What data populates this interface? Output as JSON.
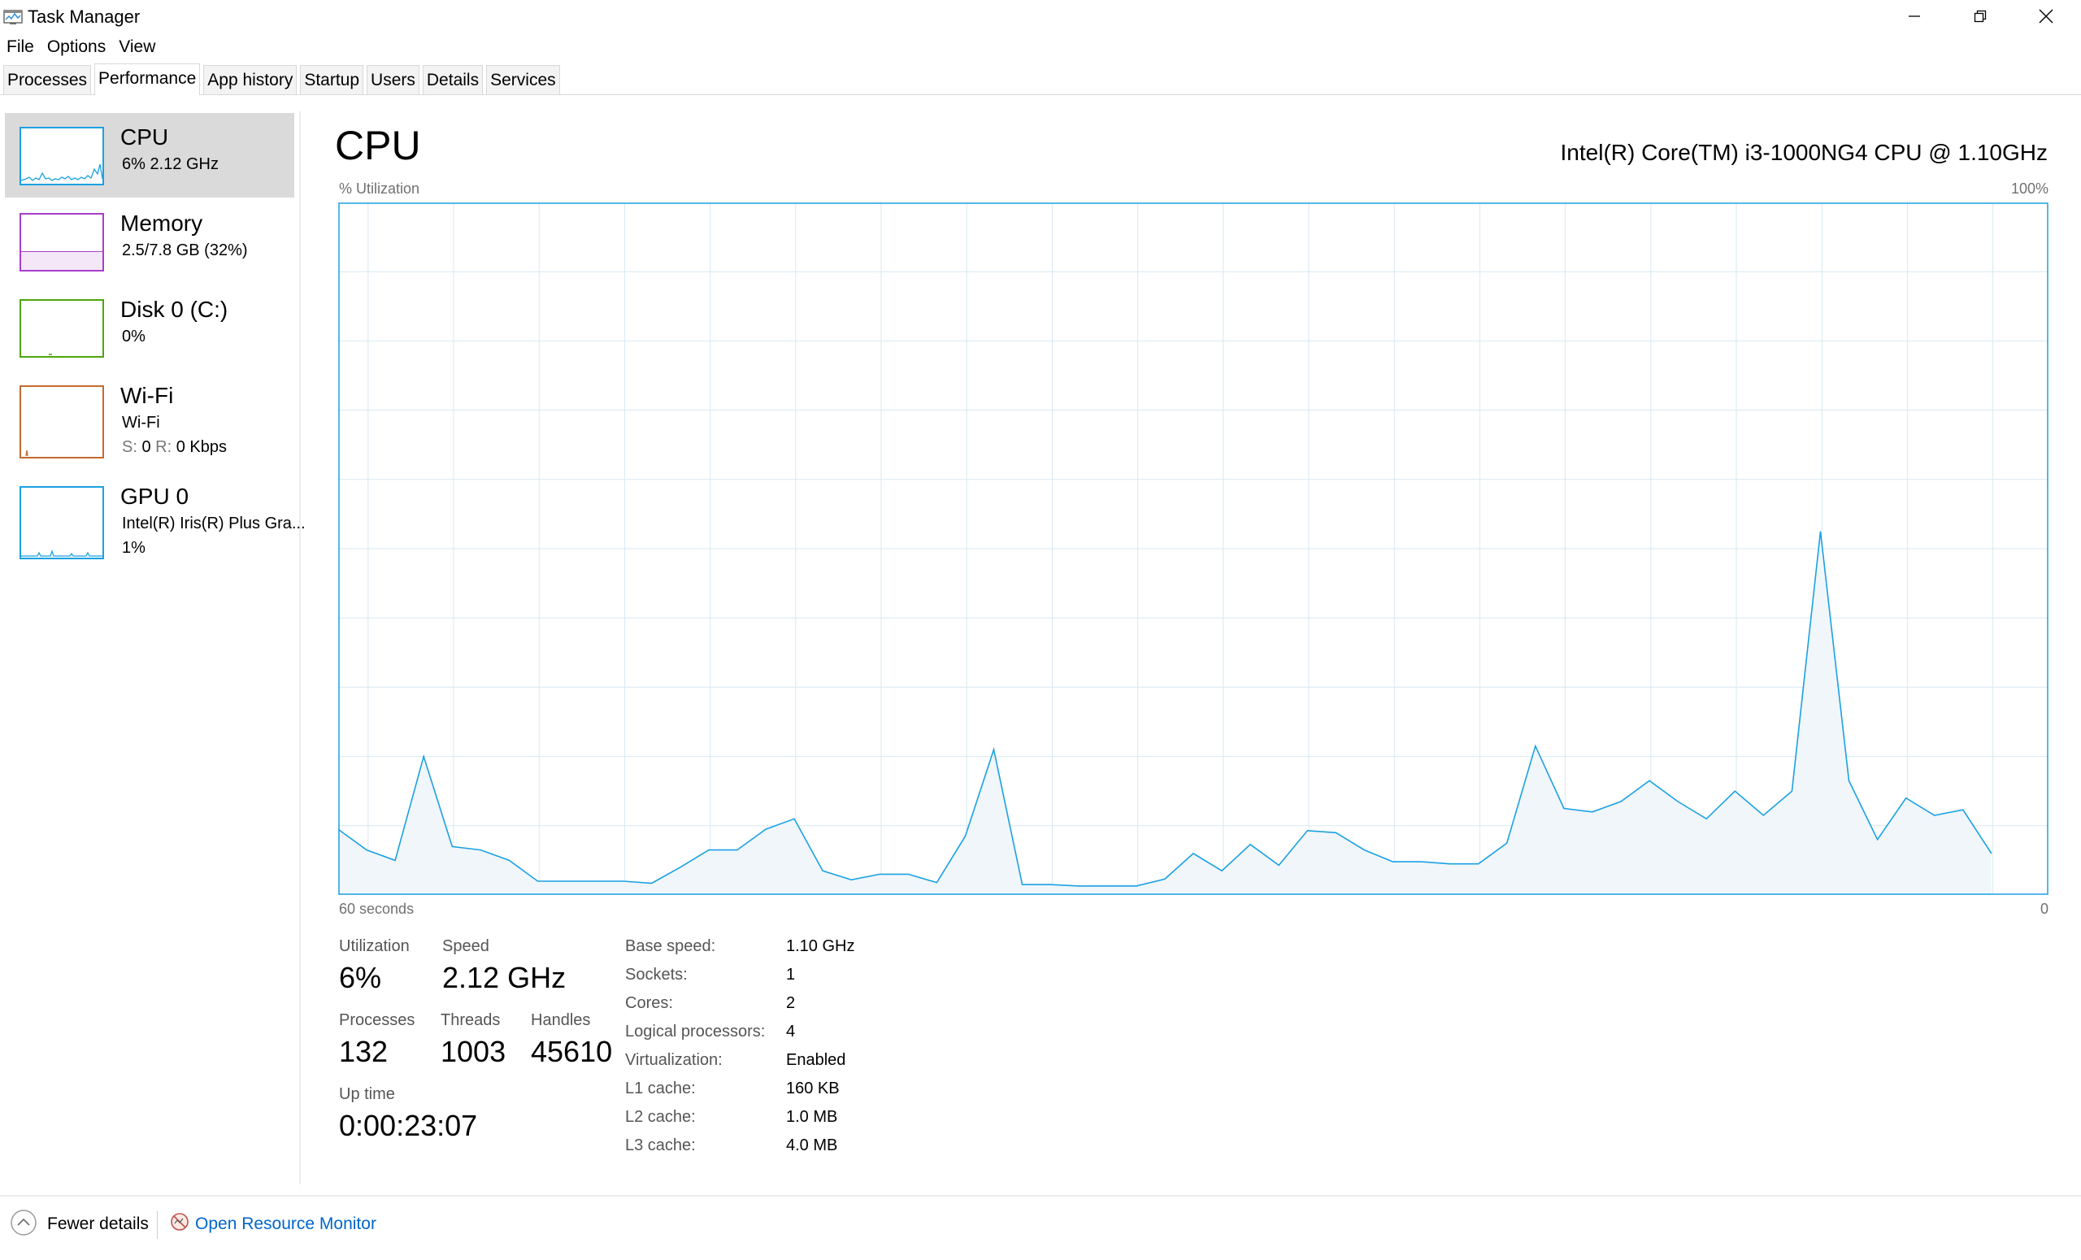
{
  "window": {
    "title": "Task Manager",
    "app_icon": "task-manager-icon",
    "controls": [
      "minimize-icon",
      "restore-icon",
      "close-icon"
    ]
  },
  "menu": [
    "File",
    "Options",
    "View"
  ],
  "tabs": [
    {
      "label": "Processes"
    },
    {
      "label": "Performance",
      "active": true
    },
    {
      "label": "App history"
    },
    {
      "label": "Startup"
    },
    {
      "label": "Users"
    },
    {
      "label": "Details"
    },
    {
      "label": "Services"
    }
  ],
  "sidebar": {
    "cpu": {
      "title": "CPU",
      "sub": "6% 2.12 GHz",
      "color": "#1ba1e2"
    },
    "memory": {
      "title": "Memory",
      "sub": "2.5/7.8 GB (32%)",
      "color": "#a83dcc",
      "level": 0.32
    },
    "disk": {
      "title": "Disk 0 (C:)",
      "sub": "0%",
      "color": "#4da60c"
    },
    "wifi": {
      "title": "Wi-Fi",
      "sub1": "Wi-Fi",
      "send_label": "S:",
      "send_value": "0",
      "recv_label": "R:",
      "recv_value": "0 Kbps",
      "color": "#c36c31"
    },
    "gpu": {
      "title": "GPU 0",
      "sub1": "Intel(R) Iris(R) Plus Gra...",
      "sub2": "1%",
      "color": "#1ba1e2"
    }
  },
  "main": {
    "title": "CPU",
    "cpu_name": "Intel(R) Core(TM) i3-1000NG4 CPU @ 1.10GHz",
    "graph": {
      "ylabel": "% Utilization",
      "ymax_label": "100%",
      "xleft_label": "60 seconds",
      "xright_label": "0",
      "line_color": "#1ba1e2",
      "grid_color": "#d6eaf2"
    },
    "stats": {
      "utilization_label": "Utilization",
      "utilization": "6%",
      "speed_label": "Speed",
      "speed": "2.12 GHz",
      "processes_label": "Processes",
      "processes": "132",
      "threads_label": "Threads",
      "threads": "1003",
      "handles_label": "Handles",
      "handles": "45610",
      "uptime_label": "Up time",
      "uptime": "0:00:23:07"
    },
    "specs": [
      {
        "label": "Base speed:",
        "value": "1.10 GHz"
      },
      {
        "label": "Sockets:",
        "value": "1"
      },
      {
        "label": "Cores:",
        "value": "2"
      },
      {
        "label": "Logical processors:",
        "value": "4"
      },
      {
        "label": "Virtualization:",
        "value": "Enabled"
      },
      {
        "label": "L1 cache:",
        "value": "160 KB"
      },
      {
        "label": "L2 cache:",
        "value": "1.0 MB"
      },
      {
        "label": "L3 cache:",
        "value": "4.0 MB"
      }
    ]
  },
  "footer": {
    "fewer_details": "Fewer details",
    "open_resource_monitor": "Open Resource Monitor"
  },
  "chart_data": {
    "type": "area",
    "ylabel": "% Utilization",
    "ylim": [
      0,
      100
    ],
    "xlim": [
      60,
      0
    ],
    "x": [
      60,
      59,
      58,
      57,
      56,
      55,
      54,
      53,
      52,
      51,
      50,
      49,
      48,
      47,
      46,
      45,
      44,
      43,
      42,
      41,
      40,
      39,
      38,
      37,
      36,
      35,
      34,
      33,
      32,
      31,
      30,
      29,
      28,
      27,
      26,
      25,
      24,
      23,
      22,
      21,
      20,
      19,
      18,
      17,
      16,
      15,
      14,
      13,
      12,
      11,
      10,
      9,
      8,
      7,
      6,
      5,
      4,
      3,
      2,
      1,
      0
    ],
    "series": [
      {
        "values": [
          9.5,
          6.5,
          5,
          20,
          7,
          6.5,
          5,
          2,
          2,
          2,
          2,
          1.7,
          4,
          6.5,
          6.5,
          9.5,
          11,
          3.5,
          2.2,
          3,
          3,
          1.8,
          8.5,
          21,
          1.5,
          1.5,
          1.3,
          1.3,
          1.3,
          2.3,
          6,
          3.5,
          7.3,
          4.3,
          9.3,
          9,
          6.5,
          4.8,
          4.8,
          4.5,
          4.5,
          7.5,
          21.5,
          12.5,
          12,
          13.5,
          16.5,
          13.5,
          11,
          15,
          11.5,
          15,
          52.5,
          16.5,
          8,
          14,
          11.5,
          12.3,
          6
        ]
      }
    ],
    "grid": true
  }
}
